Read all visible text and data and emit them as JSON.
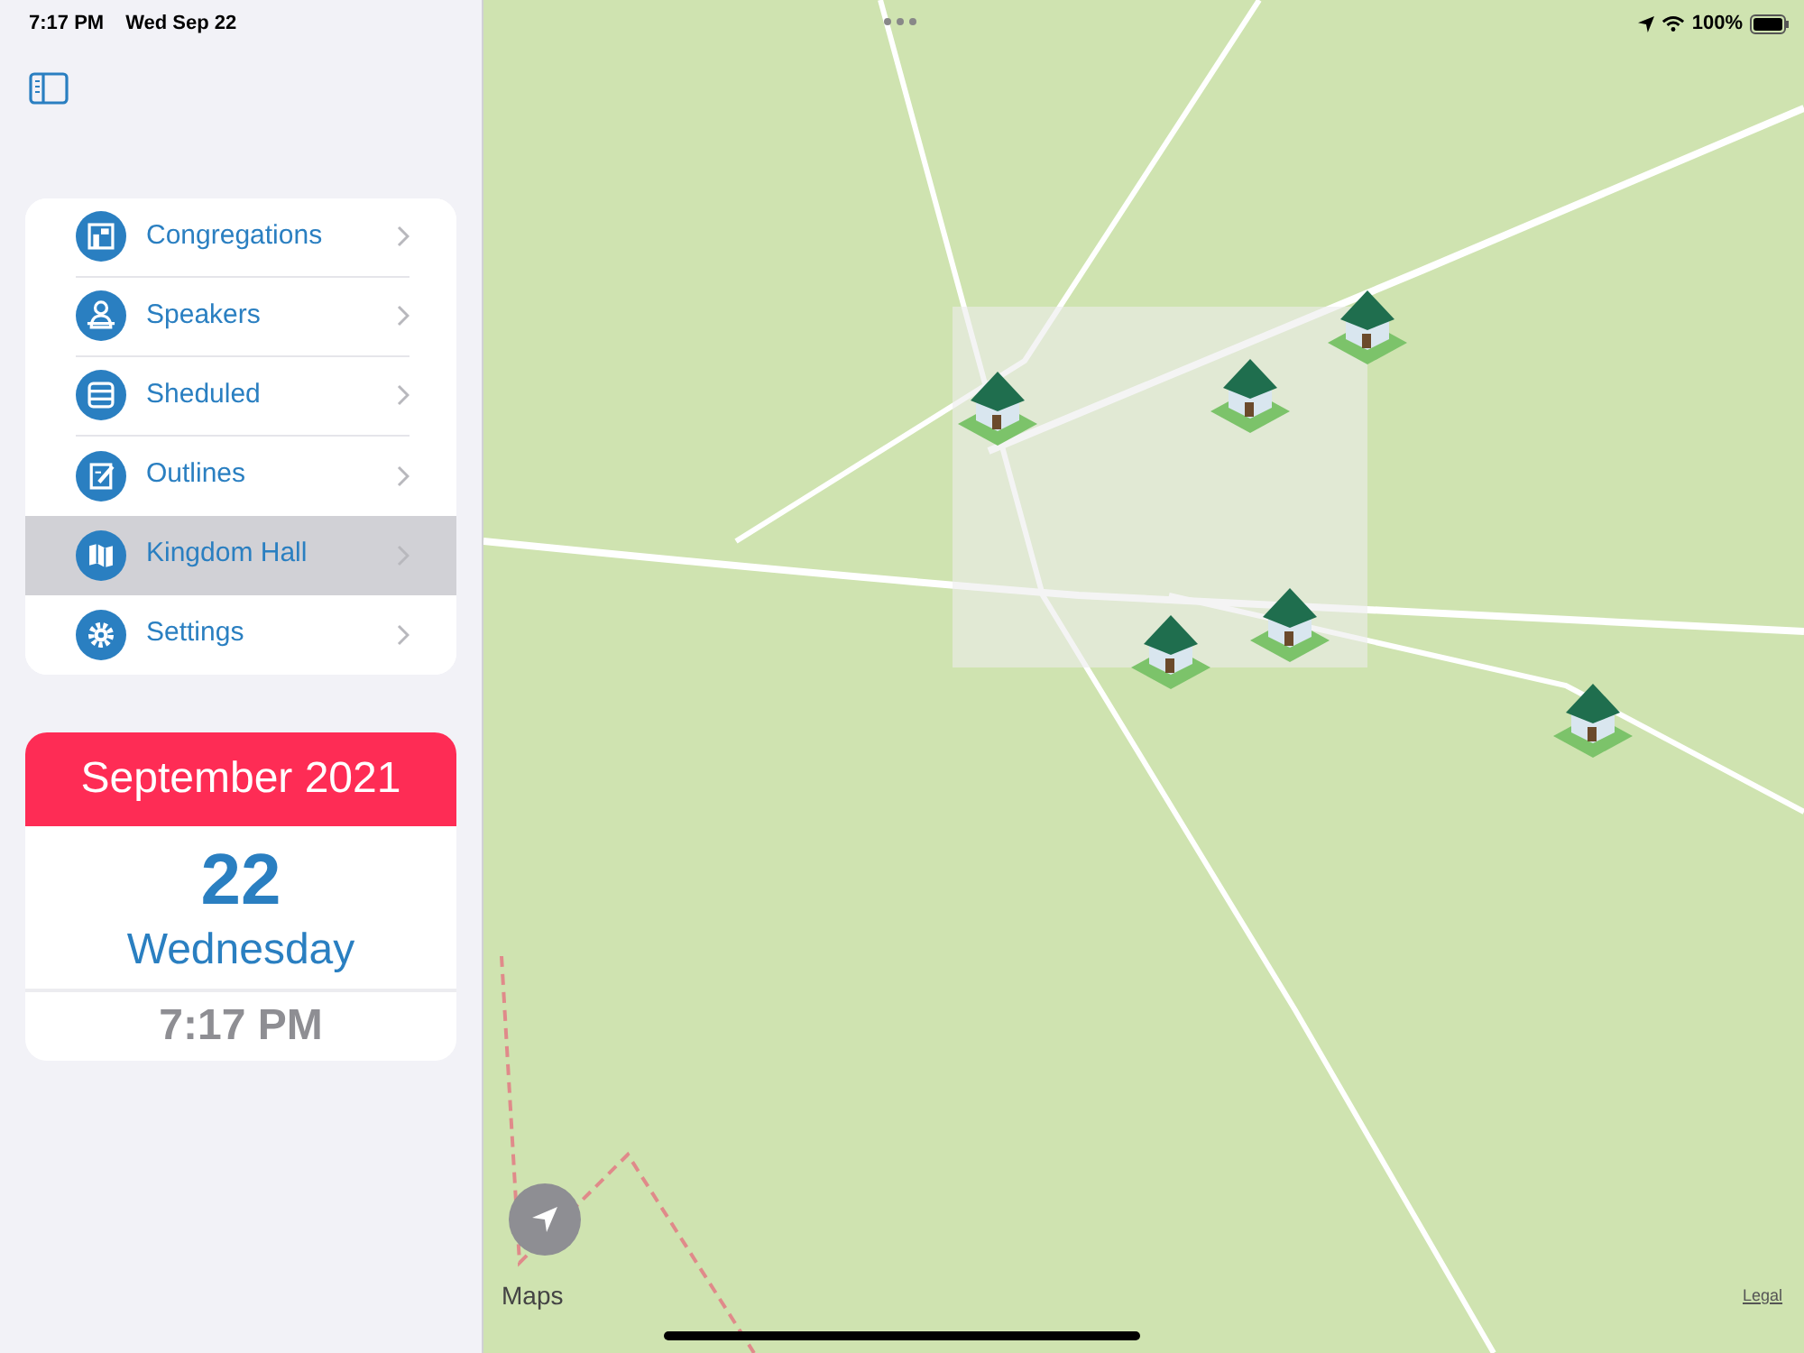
{
  "status_bar": {
    "time": "7:17 PM",
    "date": "Wed Sep 22",
    "battery": "100%"
  },
  "sidebar": {
    "items": [
      {
        "label": "Congregations",
        "selected": false
      },
      {
        "label": "Speakers",
        "selected": false
      },
      {
        "label": "Sheduled",
        "selected": false
      },
      {
        "label": "Outlines",
        "selected": false
      },
      {
        "label": "Kingdom Hall",
        "selected": true
      },
      {
        "label": "Settings",
        "selected": false
      }
    ]
  },
  "calendar": {
    "month": "September 2021",
    "day": "22",
    "weekday": "Wednesday",
    "time": "7:17 PM"
  },
  "map": {
    "attribution": "Maps",
    "legal": "Legal"
  }
}
